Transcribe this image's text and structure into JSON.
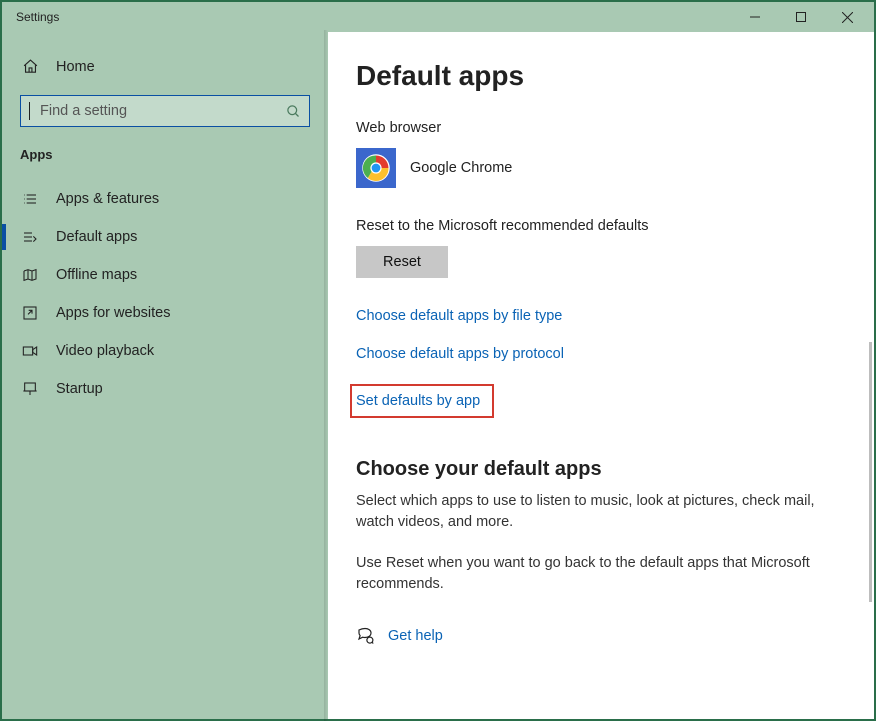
{
  "window": {
    "title": "Settings"
  },
  "sidebar": {
    "home_label": "Home",
    "search_placeholder": "Find a setting",
    "group_label": "Apps",
    "items": [
      {
        "label": "Apps & features"
      },
      {
        "label": "Default apps"
      },
      {
        "label": "Offline maps"
      },
      {
        "label": "Apps for websites"
      },
      {
        "label": "Video playback"
      },
      {
        "label": "Startup"
      }
    ]
  },
  "main": {
    "title": "Default apps",
    "web_browser": {
      "label": "Web browser",
      "app_name": "Google Chrome"
    },
    "reset_section": {
      "label": "Reset to the Microsoft recommended defaults",
      "button_label": "Reset"
    },
    "links": {
      "by_file_type": "Choose default apps by file type",
      "by_protocol": "Choose default apps by protocol",
      "by_app": "Set defaults by app"
    },
    "choose_section": {
      "heading": "Choose your default apps",
      "paragraph1": "Select which apps to use to listen to music, look at pictures, check mail, watch videos, and more.",
      "paragraph2": "Use Reset when you want to go back to the default apps that Microsoft recommends."
    },
    "help_label": "Get help"
  }
}
